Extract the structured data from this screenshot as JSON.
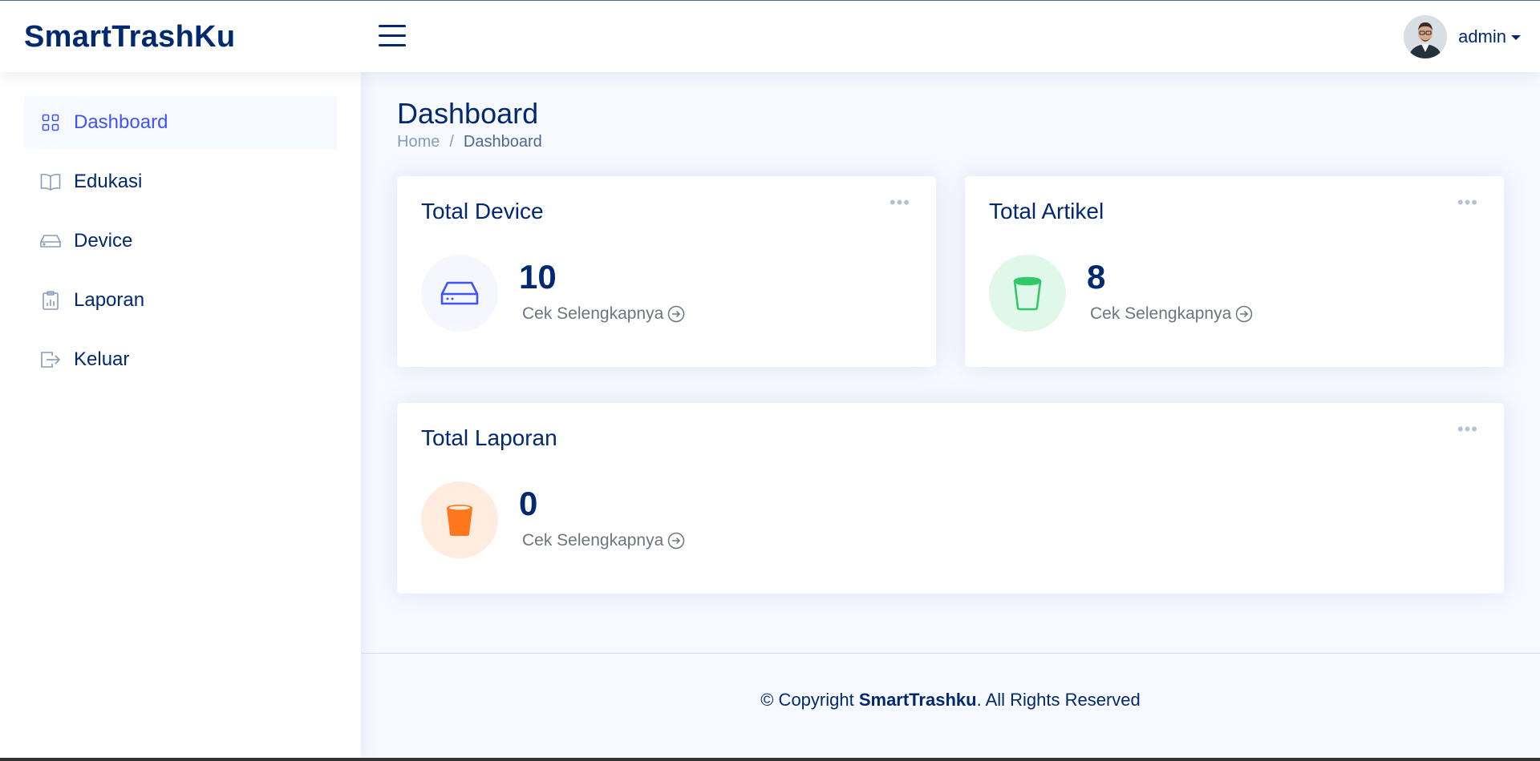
{
  "header": {
    "logo": "SmartTrashKu",
    "user_name": "admin"
  },
  "sidebar": {
    "items": [
      {
        "label": "Dashboard",
        "icon": "grid-icon",
        "active": true
      },
      {
        "label": "Edukasi",
        "icon": "book-icon",
        "active": false
      },
      {
        "label": "Device",
        "icon": "hdd-icon",
        "active": false
      },
      {
        "label": "Laporan",
        "icon": "clipboard-data-icon",
        "active": false
      },
      {
        "label": "Keluar",
        "icon": "box-arrow-right-icon",
        "active": false
      }
    ]
  },
  "page": {
    "title": "Dashboard",
    "breadcrumb": {
      "home": "Home",
      "separator": "/",
      "current": "Dashboard"
    }
  },
  "cards": {
    "device": {
      "title": "Total Device",
      "value": "10",
      "link": "Cek Selengkapnya",
      "icon": "hdd-icon",
      "color": "#4154f1",
      "bg": "#f6f6fe"
    },
    "artikel": {
      "title": "Total Artikel",
      "value": "8",
      "link": "Cek Selengkapnya",
      "icon": "trash-bin-icon",
      "color": "#2eca6a",
      "bg": "#e0f8e9"
    },
    "laporan": {
      "title": "Total Laporan",
      "value": "0",
      "link": "Cek Selengkapnya",
      "icon": "trash-bin-filled-icon",
      "color": "#ff771d",
      "bg": "#ffecdf"
    }
  },
  "footer": {
    "prefix": "© Copyright ",
    "brand": "SmartTrashku",
    "suffix": ". All Rights Reserved"
  }
}
